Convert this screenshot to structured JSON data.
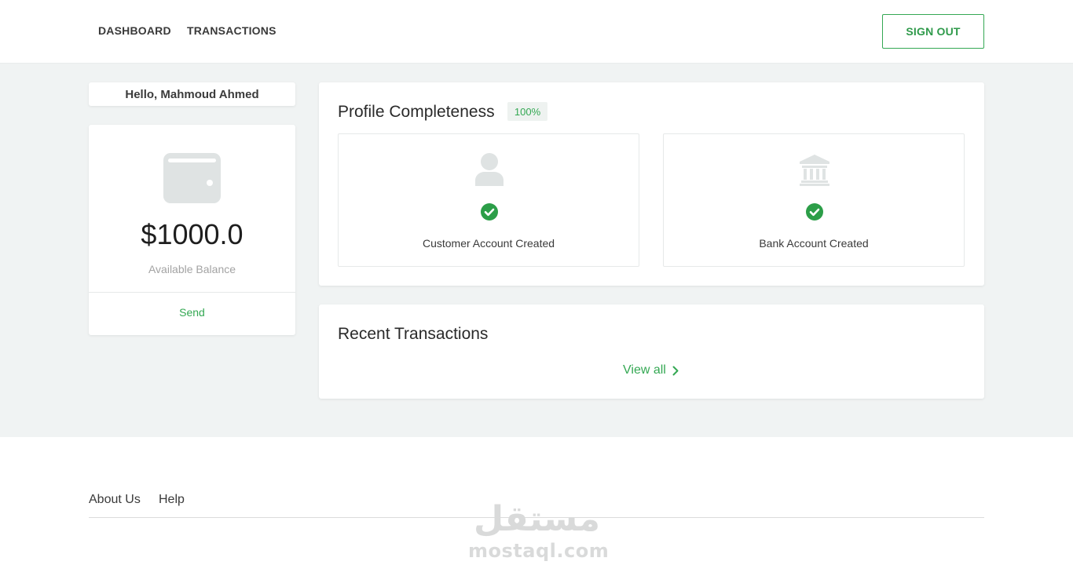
{
  "header": {
    "nav": [
      {
        "label": "DASHBOARD"
      },
      {
        "label": "TRANSACTIONS"
      }
    ],
    "sign_out_label": "SIGN OUT"
  },
  "sidebar": {
    "greeting": "Hello, Mahmoud Ahmed",
    "balance": {
      "amount": "$1000.0",
      "label": "Available Balance",
      "send_label": "Send",
      "icon": "wallet-icon"
    }
  },
  "profile": {
    "title": "Profile Completeness",
    "percent": "100%",
    "steps": [
      {
        "label": "Customer Account Created",
        "icon": "user-icon",
        "status": "complete"
      },
      {
        "label": "Bank Account Created",
        "icon": "bank-icon",
        "status": "complete"
      }
    ]
  },
  "recent": {
    "title": "Recent Transactions",
    "view_all_label": "View all"
  },
  "footer": {
    "links": [
      {
        "label": "About Us"
      },
      {
        "label": "Help"
      }
    ]
  },
  "watermark": {
    "arabic": "مستقل",
    "latin": "mostaql.com"
  },
  "colors": {
    "accent": "#34a853",
    "background": "#f0f3f3",
    "icon_muted": "#dfe3e3"
  }
}
